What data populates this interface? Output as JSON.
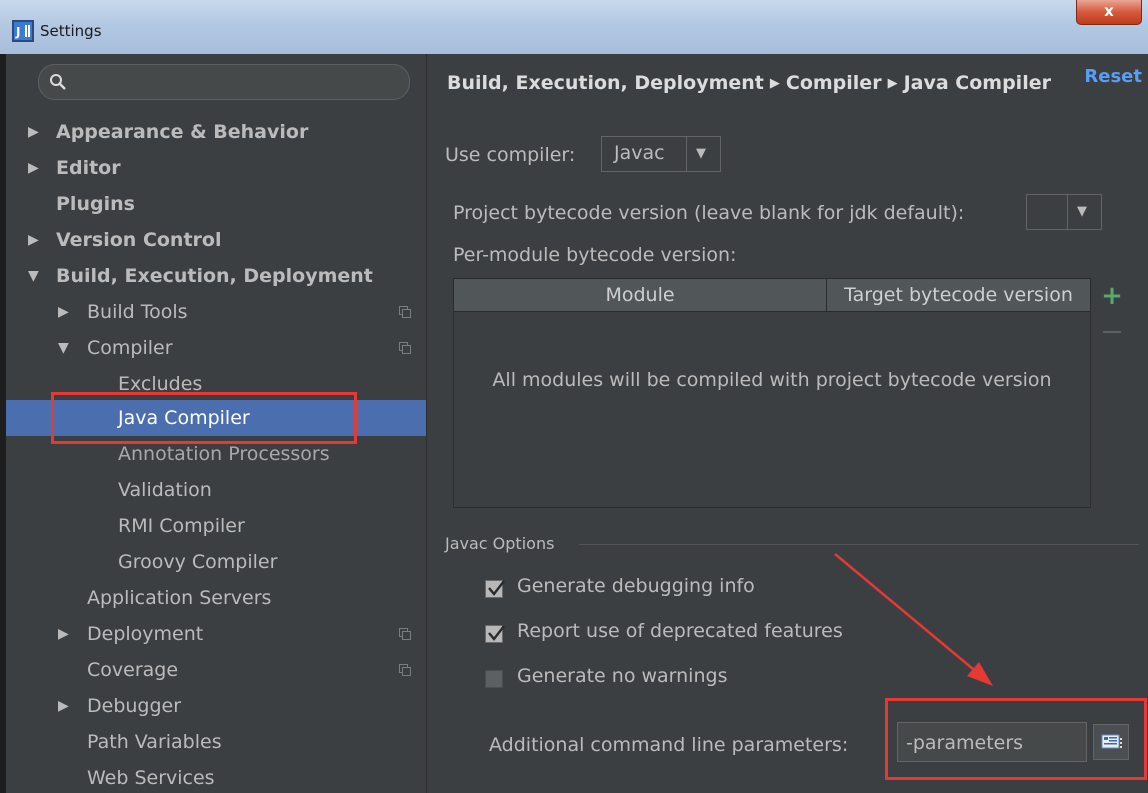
{
  "window": {
    "title": "Settings",
    "close_label": "x"
  },
  "search": {
    "value": "",
    "placeholder": ""
  },
  "sidebar": {
    "items": [
      {
        "label": "Appearance & Behavior",
        "expanded": false
      },
      {
        "label": "Editor",
        "expanded": false
      },
      {
        "label": "Plugins"
      },
      {
        "label": "Version Control",
        "expanded": false
      },
      {
        "label": "Build, Execution, Deployment",
        "expanded": true
      },
      {
        "label": "Build Tools",
        "expanded": false
      },
      {
        "label": "Compiler",
        "expanded": true
      },
      {
        "label": "Excludes"
      },
      {
        "label": "Java Compiler",
        "selected": true
      },
      {
        "label": "Annotation Processors"
      },
      {
        "label": "Validation"
      },
      {
        "label": "RMI Compiler"
      },
      {
        "label": "Groovy Compiler"
      },
      {
        "label": "Application Servers"
      },
      {
        "label": "Deployment",
        "expanded": false
      },
      {
        "label": "Coverage"
      },
      {
        "label": "Debugger",
        "expanded": false
      },
      {
        "label": "Path Variables"
      },
      {
        "label": "Web Services"
      }
    ]
  },
  "breadcrumb": {
    "part1": "Build, Execution, Deployment",
    "part2": "Compiler",
    "part3": "Java Compiler"
  },
  "reset_label": "Reset",
  "compiler": {
    "use_label": "Use compiler:",
    "selected": "Javac"
  },
  "bytecode": {
    "project_label": "Project bytecode version (leave blank for jdk default):",
    "project_value": "",
    "per_module_label": "Per-module bytecode version:"
  },
  "module_table": {
    "columns": [
      "Module",
      "Target bytecode version"
    ],
    "empty_text": "All modules will be compiled with project bytecode version"
  },
  "javac_options": {
    "title": "Javac Options",
    "options": [
      {
        "label": "Generate debugging info",
        "checked": true
      },
      {
        "label": "Report use of deprecated features",
        "checked": true
      },
      {
        "label": "Generate no warnings",
        "checked": false
      }
    ],
    "params_label": "Additional command line parameters:",
    "params_value": "-parameters"
  },
  "colors": {
    "background": "#3c3f41",
    "selection": "#4b6eaf",
    "link": "#589df6",
    "highlight": "#e53935",
    "add_green": "#59a869"
  }
}
